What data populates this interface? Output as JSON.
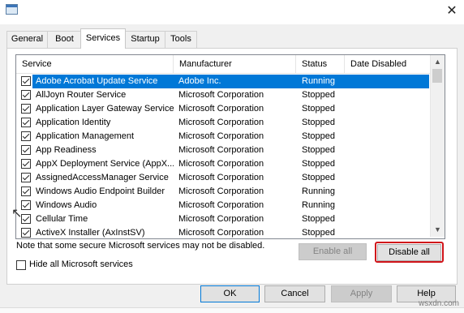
{
  "window": {
    "close_glyph": "✕"
  },
  "tabs": [
    "General",
    "Boot",
    "Services",
    "Startup",
    "Tools"
  ],
  "active_tab": "Services",
  "columns": [
    "Service",
    "Manufacturer",
    "Status",
    "Date Disabled"
  ],
  "services": [
    {
      "name": "Adobe Acrobat Update Service",
      "manufacturer": "Adobe Inc.",
      "status": "Running",
      "checked": true,
      "selected": true
    },
    {
      "name": "AllJoyn Router Service",
      "manufacturer": "Microsoft Corporation",
      "status": "Stopped",
      "checked": true
    },
    {
      "name": "Application Layer Gateway Service",
      "manufacturer": "Microsoft Corporation",
      "status": "Stopped",
      "checked": true
    },
    {
      "name": "Application Identity",
      "manufacturer": "Microsoft Corporation",
      "status": "Stopped",
      "checked": true
    },
    {
      "name": "Application Management",
      "manufacturer": "Microsoft Corporation",
      "status": "Stopped",
      "checked": true
    },
    {
      "name": "App Readiness",
      "manufacturer": "Microsoft Corporation",
      "status": "Stopped",
      "checked": true
    },
    {
      "name": "AppX Deployment Service (AppX...",
      "manufacturer": "Microsoft Corporation",
      "status": "Stopped",
      "checked": true
    },
    {
      "name": "AssignedAccessManager Service",
      "manufacturer": "Microsoft Corporation",
      "status": "Stopped",
      "checked": true
    },
    {
      "name": "Windows Audio Endpoint Builder",
      "manufacturer": "Microsoft Corporation",
      "status": "Running",
      "checked": true
    },
    {
      "name": "Windows Audio",
      "manufacturer": "Microsoft Corporation",
      "status": "Running",
      "checked": true
    },
    {
      "name": "Cellular Time",
      "manufacturer": "Microsoft Corporation",
      "status": "Stopped",
      "checked": true
    },
    {
      "name": "ActiveX Installer (AxInstSV)",
      "manufacturer": "Microsoft Corporation",
      "status": "Stopped",
      "checked": true
    }
  ],
  "note": "Note that some secure Microsoft services may not be disabled.",
  "buttons": {
    "enable_all": "Enable all",
    "disable_all": "Disable all",
    "ok": "OK",
    "cancel": "Cancel",
    "apply": "Apply",
    "help": "Help"
  },
  "hide_ms_label": "Hide all Microsoft services",
  "colors": {
    "selection": "#0078d7",
    "highlight": "#d0141a"
  },
  "watermark": "wsxdn.com"
}
